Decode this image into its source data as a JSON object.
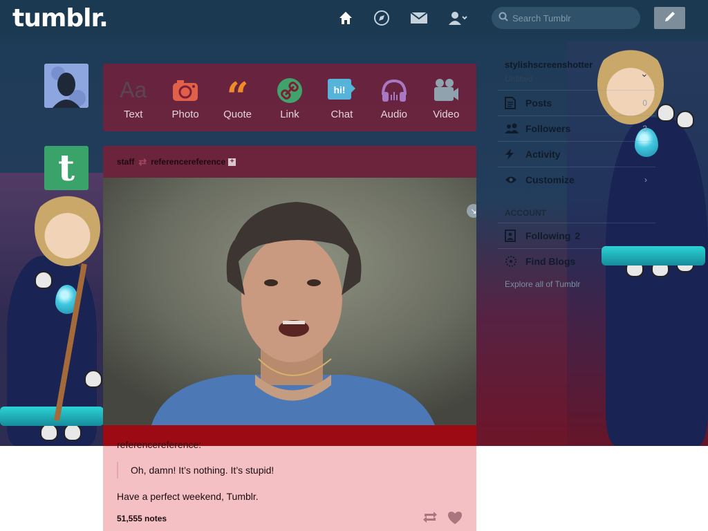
{
  "header": {
    "logo": "tumblr.",
    "search_placeholder": "Search Tumblr",
    "nav_icons": [
      "home-icon",
      "explore-icon",
      "inbox-icon",
      "account-icon"
    ],
    "compose_icon": "pencil-icon"
  },
  "post_types": [
    {
      "label": "Text",
      "icon": "text-icon",
      "color": "#4b3a45"
    },
    {
      "label": "Photo",
      "icon": "camera-icon",
      "color": "#e0604a"
    },
    {
      "label": "Quote",
      "icon": "quote-icon",
      "color": "#f08c28"
    },
    {
      "label": "Link",
      "icon": "link-icon",
      "color": "#3fa36b"
    },
    {
      "label": "Chat",
      "icon": "chat-icon",
      "color": "#56b3d9"
    },
    {
      "label": "Audio",
      "icon": "headphones-icon",
      "color": "#a978c4"
    },
    {
      "label": "Video",
      "icon": "video-camera-icon",
      "color": "#8fa2ad"
    }
  ],
  "post": {
    "author": "staff",
    "reblogged_from": "referencereference",
    "source_user": "referencereference:",
    "quote": "Oh, damn! It’s nothing. It’s stupid!",
    "body": "Have a perfect weekend, Tumblr.",
    "notes": "51,555 notes"
  },
  "sidebar": {
    "blog_name": "stylishscreenshotter",
    "blog_sub": "Untitled",
    "items": [
      {
        "label": "Posts",
        "count": "0",
        "icon": "posts-icon"
      },
      {
        "label": "Followers",
        "count": "3",
        "icon": "followers-icon"
      },
      {
        "label": "Activity",
        "count": "",
        "icon": "activity-icon"
      },
      {
        "label": "Customize",
        "count": "›",
        "icon": "eye-icon"
      }
    ],
    "account_heading": "ACCOUNT",
    "account_items": [
      {
        "label": "Following",
        "count": "2",
        "icon": "following-icon"
      },
      {
        "label": "Find Blogs",
        "count": "",
        "icon": "find-blogs-icon"
      }
    ],
    "explore": "Explore all of Tumblr"
  }
}
